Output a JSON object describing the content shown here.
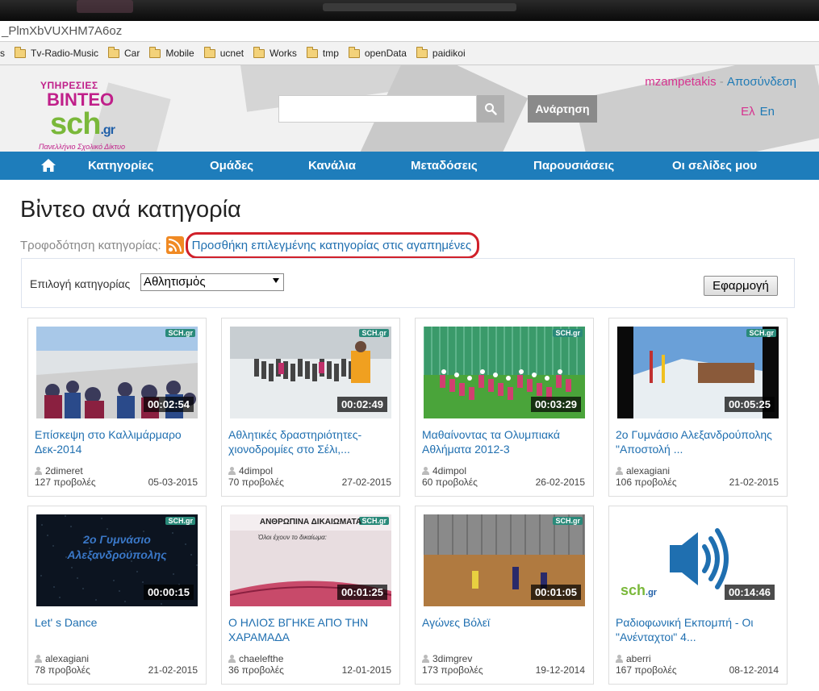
{
  "browser": {
    "url_fragment": "_PlmXbVUXHM7A6oz",
    "bookmarks": [
      {
        "label": "s",
        "folder": false
      },
      {
        "label": "Tv-Radio-Music",
        "folder": true
      },
      {
        "label": "Car",
        "folder": true
      },
      {
        "label": "Mobile",
        "folder": true
      },
      {
        "label": "ucnet",
        "folder": true
      },
      {
        "label": "Works",
        "folder": true
      },
      {
        "label": "tmp",
        "folder": true
      },
      {
        "label": "openData",
        "folder": true
      },
      {
        "label": "paidikoi",
        "folder": true
      }
    ]
  },
  "header": {
    "logo": {
      "line1": "ΥΠΗΡΕΣΙΕΣ",
      "line2": "ΒΙΝΤΕΟ",
      "line3": "sch",
      "line3_suffix": ".gr",
      "tagline": "Πανελλήνιο Σχολικό Δίκτυο"
    },
    "search_placeholder": "",
    "upload_label": "Ανάρτηση",
    "username": "mzampetakis",
    "separator": " - ",
    "logout_label": "Αποσύνδεση",
    "lang_el": "Ελ",
    "lang_en": "En"
  },
  "nav": {
    "items": [
      {
        "label": "Κατηγορίες"
      },
      {
        "label": "Ομάδες"
      },
      {
        "label": "Κανάλια"
      },
      {
        "label": "Μεταδόσεις"
      },
      {
        "label": "Παρουσιάσεις"
      },
      {
        "label": "Οι σελίδες μου"
      }
    ]
  },
  "main": {
    "title": "Βἰντεο ανά κατηγορία",
    "feed_label": "Τροφοδότηση κατηγορίας:",
    "favorite_link": "Προσθήκη επιλεγμένης κατηγορίας στις αγαπημένες",
    "filter_label": "Επιλογή κατηγορίας",
    "filter_value": "Αθλητισμὀς",
    "apply_label": "Εφαρμογή"
  },
  "videos": [
    {
      "title": "Επίσκεψη στο Καλλιμάρμαρο Δεκ-2014",
      "author": "2dimeret",
      "views": "127 προβολές",
      "date": "05-03-2015",
      "duration": "00:02:54"
    },
    {
      "title": "Αθλητικές δραστηριότητες-χιονοδρομίες στο Σέλι,...",
      "author": "4dimpol",
      "views": "70 προβολές",
      "date": "27-02-2015",
      "duration": "00:02:49"
    },
    {
      "title": "Μαθαίνοντας τα Ολυμπιακά Αθλήματα 2012-3",
      "author": "4dimpol",
      "views": "60 προβολές",
      "date": "26-02-2015",
      "duration": "00:03:29"
    },
    {
      "title": "2ο Γυμνάσιο Αλεξανδρούπολης \"Αποστολή ...",
      "author": "alexagiani",
      "views": "106 προβολές",
      "date": "21-02-2015",
      "duration": "00:05:25"
    },
    {
      "title": "Let' s Dance",
      "author": "alexagiani",
      "views": "78 προβολές",
      "date": "21-02-2015",
      "duration": "00:00:15"
    },
    {
      "title": "Ο ΗΛΙΟΣ ΒΓΗΚΕ ΑΠΟ ΤΗΝ ΧΑΡΑΜΑΔΑ",
      "author": "chaelefthe",
      "views": "36 προβολές",
      "date": "12-01-2015",
      "duration": "00:01:25"
    },
    {
      "title": "Αγώνες Βόλεϊ",
      "author": "3dimgrev",
      "views": "173 προβολές",
      "date": "19-12-2014",
      "duration": "00:01:05"
    },
    {
      "title": "Ραδιοφωνική Εκπομπή - Οι \"Ανένταχτοι\" 4...",
      "author": "aberri",
      "views": "167 προβολές",
      "date": "08-12-2014",
      "duration": "00:14:46"
    }
  ],
  "thumb_text": {
    "badge": "SCH.gr",
    "t5_line1": "2ο Γυμνάσιο",
    "t5_line2": "Αλεξανδρούπολης",
    "t6_heading": "ΑΝΘΡΩΠΙΝΑ ΔΙΚΑΙΩΜΑΤΑ",
    "t6_body": "Όλοι έχουν το δικαίωμα:",
    "t8_logo": "sch",
    "t8_logo_suffix": ".gr"
  },
  "colors": {
    "nav_blue": "#1e7dbb",
    "link_blue": "#1f6fb0",
    "brand_pink": "#d6338f",
    "brand_green": "#7ab83a",
    "highlight_red": "#d0202a"
  }
}
